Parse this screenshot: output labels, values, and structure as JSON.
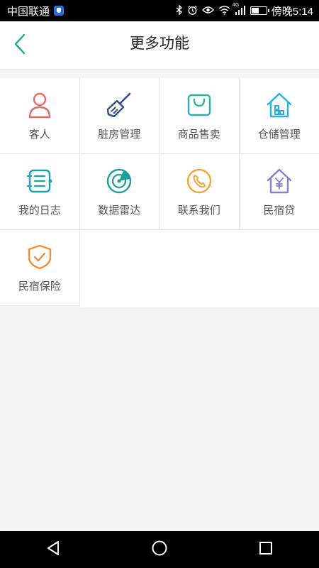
{
  "status_bar": {
    "carrier": "中国联通",
    "network_label": "4G",
    "time": "傍晚5:14",
    "battery_level": 0.55,
    "icons": [
      "bluetooth-icon",
      "alarm-icon",
      "eye-icon",
      "wifi-icon",
      "signal-icon",
      "battery-icon"
    ]
  },
  "header": {
    "title": "更多功能",
    "back_icon": "chevron-left-icon"
  },
  "colors": {
    "accent_green": "#2aa98c",
    "guest_red": "#e06b6b",
    "broom_navy": "#3a4b80",
    "shop_teal": "#2db39e",
    "house_cyan": "#2bb0d6",
    "diary_teal": "#1ea3a8",
    "radar_teal": "#1f9f9a",
    "contact_orange": "#f0a43a",
    "loan_purple": "#8a7fc6",
    "insurance_orange": "#f08c3a"
  },
  "features": [
    {
      "label": "客人",
      "icon": "person-icon"
    },
    {
      "label": "脏房管理",
      "icon": "broom-icon"
    },
    {
      "label": "商品售卖",
      "icon": "shopping-bag-icon"
    },
    {
      "label": "仓储管理",
      "icon": "warehouse-house-icon"
    },
    {
      "label": "我的日志",
      "icon": "journal-icon"
    },
    {
      "label": "数据雷达",
      "icon": "radar-icon"
    },
    {
      "label": "联系我们",
      "icon": "phone-icon"
    },
    {
      "label": "民宿贷",
      "icon": "yuan-house-icon"
    },
    {
      "label": "民宿保险",
      "icon": "shield-check-icon"
    }
  ],
  "nav_bar": {
    "buttons": [
      "back-triangle-icon",
      "home-circle-icon",
      "recent-square-icon"
    ]
  }
}
